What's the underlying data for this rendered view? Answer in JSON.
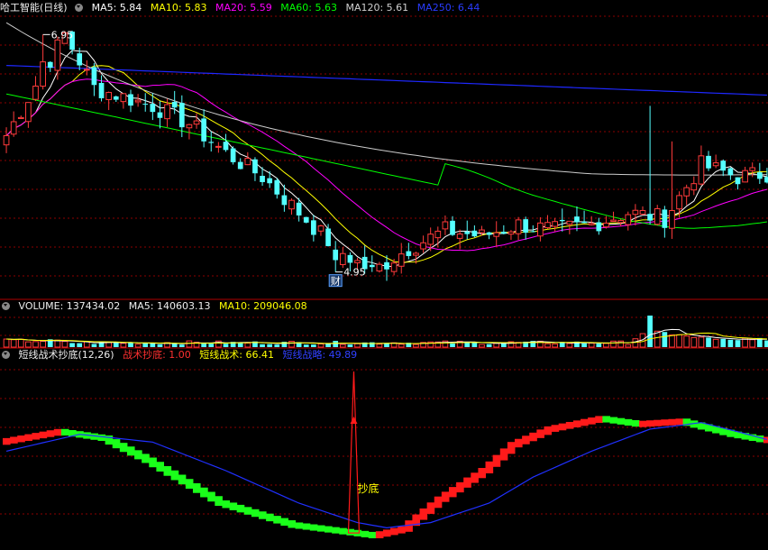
{
  "header": {
    "stock_name": "哈工智能(日线)",
    "ma5": "MA5: 5.84",
    "ma10": "MA10: 5.83",
    "ma20": "MA20: 5.59",
    "ma60": "MA60: 5.63",
    "ma120": "MA120: 5.61",
    "ma250": "MA250: 6.44"
  },
  "volume_header": {
    "volume": "VOLUME: 137434.02",
    "ma5": "MA5: 140603.13",
    "ma10": "MA10: 209046.08"
  },
  "indicator_header": {
    "name": "短线战术抄底(12,26)",
    "signal": "战术抄底: 1.00",
    "short_tactic": "短线战术: 66.41",
    "short_strategy": "短线战略: 49.89"
  },
  "colors": {
    "up": "#ff3b3b",
    "down": "#54ffff",
    "ma5": "#ffffff",
    "ma10": "#ffff00",
    "ma20": "#ff00ff",
    "ma60": "#00ff00",
    "ma120": "#cccccc",
    "ma250": "#1e28ff",
    "grid": "#8b0000",
    "ind_up": "#ff1a1a",
    "ind_down": "#1aff1a",
    "ind_line": "#2030ff"
  },
  "chart_data": [
    {
      "type": "candlestick",
      "annotations": {
        "high_label": "6.95",
        "low_label": "4.95",
        "event_marker": "财"
      },
      "series_key_points": [
        {
          "name": "Price",
          "x": [
            0,
            8,
            12,
            20,
            25,
            30,
            35,
            40,
            45,
            50,
            55,
            60,
            65,
            70,
            75,
            80,
            85,
            90,
            95,
            100,
            104
          ],
          "values": [
            6.1,
            6.95,
            6.5,
            6.35,
            6.2,
            5.95,
            5.75,
            5.45,
            5.15,
            4.95,
            5.15,
            5.3,
            5.25,
            5.35,
            5.3,
            5.35,
            5.45,
            5.4,
            5.85,
            5.75,
            5.78
          ]
        },
        {
          "name": "MA250",
          "x": [
            0,
            104
          ],
          "values": [
            6.69,
            6.44
          ]
        }
      ]
    },
    {
      "type": "bar",
      "title": "VOLUME"
    },
    {
      "type": "line",
      "annotations": {
        "signal_label": "抄底"
      },
      "series": [
        {
          "name": "短线战术",
          "x": [
            0,
            8,
            14,
            20,
            30,
            40,
            47,
            51,
            55,
            60,
            66,
            70,
            75,
            82,
            87,
            93,
            100,
            104
          ],
          "values": [
            72,
            80,
            75,
            58,
            25,
            8,
            3,
            0,
            5,
            28,
            50,
            70,
            82,
            90,
            86,
            88,
            78,
            74
          ]
        },
        {
          "name": "短线战略",
          "x": [
            0,
            10,
            20,
            30,
            40,
            48,
            52,
            58,
            66,
            72,
            80,
            88,
            95,
            100,
            104
          ],
          "values": [
            65,
            78,
            72,
            50,
            25,
            10,
            6,
            10,
            25,
            45,
            65,
            82,
            87,
            80,
            74
          ]
        }
      ]
    }
  ]
}
